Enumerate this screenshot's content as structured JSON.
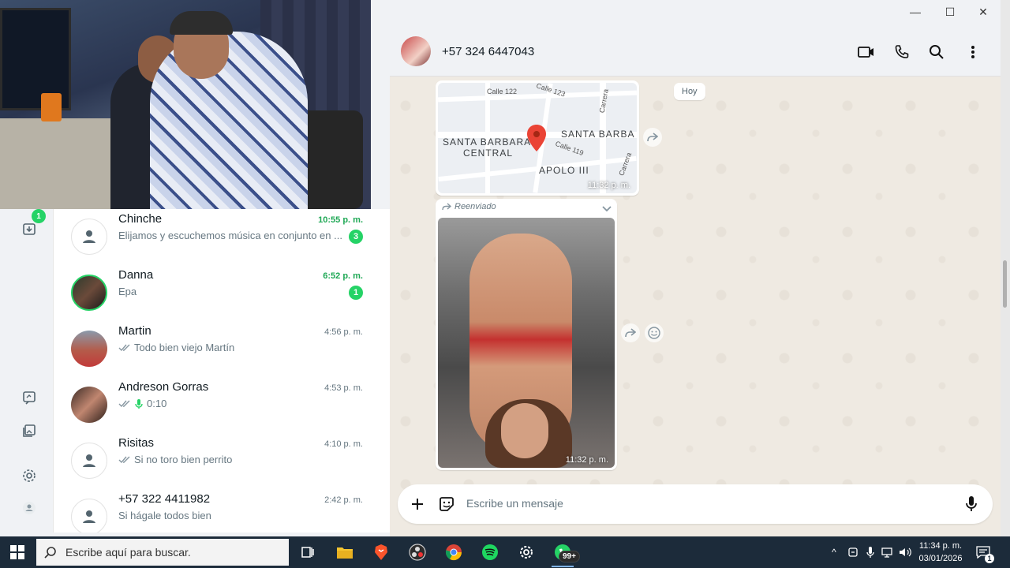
{
  "window": {
    "controls": {
      "minimize": "—",
      "maximize": "☐",
      "close": "✕"
    }
  },
  "rail": {
    "archive_badge": "1"
  },
  "chats": [
    {
      "name": "Chinche",
      "time": "10:55 p. m.",
      "preview": "Elijamos y escuchemos música en conjunto en ...",
      "unread": "3",
      "time_unread": true
    },
    {
      "name": "Danna",
      "time": "6:52 p. m.",
      "preview": "Epa",
      "unread": "1",
      "time_unread": true
    },
    {
      "name": "Martin",
      "time": "4:56 p. m.",
      "preview": "Todo bien viejo Martín",
      "read_ticks": true
    },
    {
      "name": "Andreson Gorras",
      "time": "4:53 p. m.",
      "preview": "0:10",
      "read_ticks": true,
      "voice": true
    },
    {
      "name": "Risitas",
      "time": "4:10 p. m.",
      "preview": "Si no toro bien perrito",
      "read_ticks": true
    },
    {
      "name": "+57 322 4411982",
      "time": "2:42 p. m.",
      "preview": "Si hágale todos bien"
    }
  ],
  "conversation": {
    "title": "+57 324 6447043",
    "day_chip": "Hoy",
    "map_message": {
      "time": "11:32 p. m.",
      "labels": {
        "big1": "SANTA BARBARA",
        "big1b": "CENTRAL",
        "big2": "SANTA BARBA",
        "big3": "APOLO III"
      },
      "small": {
        "s1": "Calle 122",
        "s2": "Calle 123",
        "s3": "Carrera",
        "s4": "Calle 119",
        "s5": "Carrera"
      }
    },
    "photo_message": {
      "forwarded_label": "Reenviado",
      "time": "11:32 p. m."
    },
    "composer": {
      "placeholder": "Escribe un mensaje"
    }
  },
  "taskbar": {
    "search_placeholder": "Escribe aquí para buscar.",
    "whatsapp_badge": "99+",
    "clock_time": "11:34 p. m.",
    "clock_date": "03/01/2026",
    "notification_count": "1"
  }
}
